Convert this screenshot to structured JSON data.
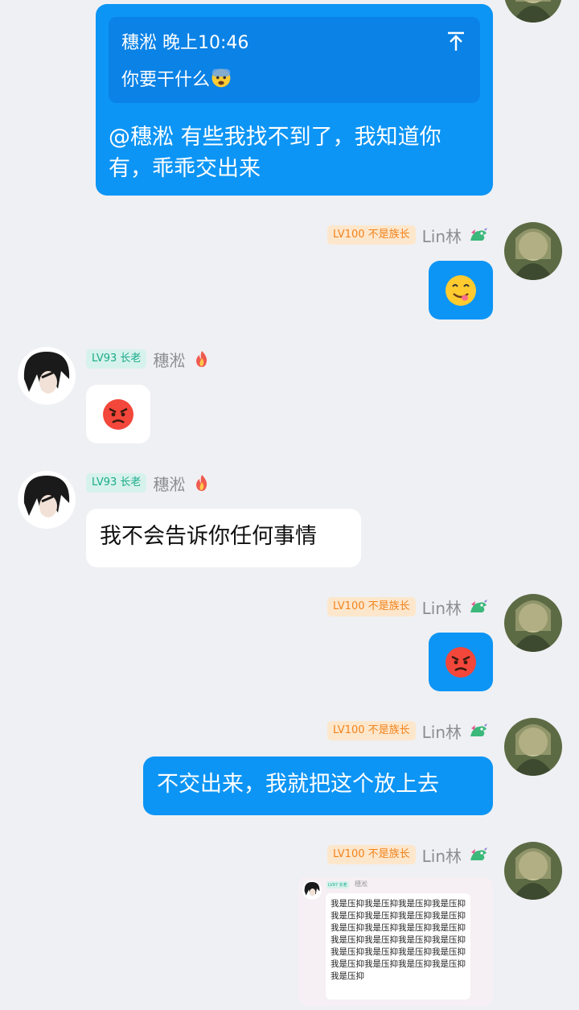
{
  "messages": {
    "m1": {
      "quote_sender": "穗淞",
      "quote_time": "晚上10:46",
      "quote_text": "你要干什么",
      "reply_line1": "@穗淞 有些我找不到了，我知道你",
      "reply_line2": "有，乖乖交出来"
    },
    "m2": {
      "level_badge": "LV100 不是族长",
      "nickname": "Lin林",
      "emoji": "yum-face"
    },
    "m3": {
      "level_badge": "LV93 长老",
      "nickname": "穗淞",
      "emoji": "angry-face"
    },
    "m4": {
      "level_badge": "LV93 长老",
      "nickname": "穗淞",
      "text": "我不会告诉你任何事情"
    },
    "m5": {
      "level_badge": "LV100 不是族长",
      "nickname": "Lin林",
      "emoji": "angry-face"
    },
    "m6": {
      "level_badge": "LV100 不是族长",
      "nickname": "Lin林",
      "text": "不交出来，我就把这个放上去"
    },
    "m7": {
      "level_badge": "LV100 不是族长",
      "nickname": "Lin林",
      "image": {
        "mini_badge": "LV97 长老",
        "mini_name": "穗淞",
        "text": "我是压抑我是压抑我是压抑我是压抑我是压抑我是压抑我是压抑我是压抑我是压抑我是压抑我是压抑我是压抑我是压抑我是压抑我是压抑我是压抑我是压抑我是压抑我是压抑我是压抑我是压抑我是压抑我是压抑我是压抑我是压抑"
      }
    }
  },
  "colors": {
    "accent_blue": "#0d95f5",
    "quote_blue": "#0a82e6",
    "background": "#eff0f3",
    "badge_orange": "#f2821b",
    "badge_teal": "#1aab8a"
  }
}
